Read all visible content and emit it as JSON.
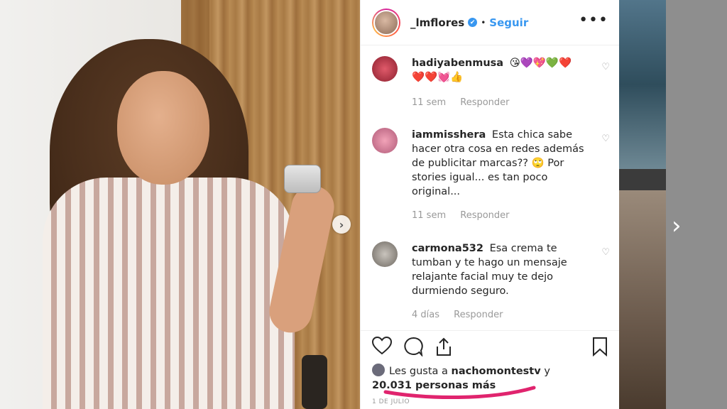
{
  "post": {
    "username": "_lmflores",
    "verified_icon": "✔",
    "dot": "•",
    "follow_label": "Seguir",
    "more_icon": "•••"
  },
  "comments": [
    {
      "user": "hadiyabenmusa",
      "text": "😘💜💖💚❤️ ❤️❤️💓👍",
      "age": "11 sem",
      "reply": "Responder"
    },
    {
      "user": "iammisshera",
      "text": "Esta chica sabe hacer otra cosa en redes además de publicitar marcas?? 🙄 Por stories igual... es tan poco original...",
      "age": "11 sem",
      "reply": "Responder"
    },
    {
      "user": "carmona532",
      "text": "Esa crema te tumban y te hago un mensaje relajante facial muy te dejo durmiendo seguro.",
      "age": "4 días",
      "reply": "Responder"
    }
  ],
  "likes": {
    "prefix": "Les gusta a",
    "user": "nachomontestv",
    "connector": "y",
    "count": "20.031 personas más"
  },
  "date": "1 DE JULIO",
  "icons": {
    "heart": "♡",
    "comment": "comment-icon",
    "share": "share-icon",
    "bookmark": "bookmark-icon",
    "next": "›"
  },
  "colors": {
    "accent": "#3897f0",
    "text": "#262626",
    "muted": "#999999",
    "annotation": "#e0246e"
  }
}
